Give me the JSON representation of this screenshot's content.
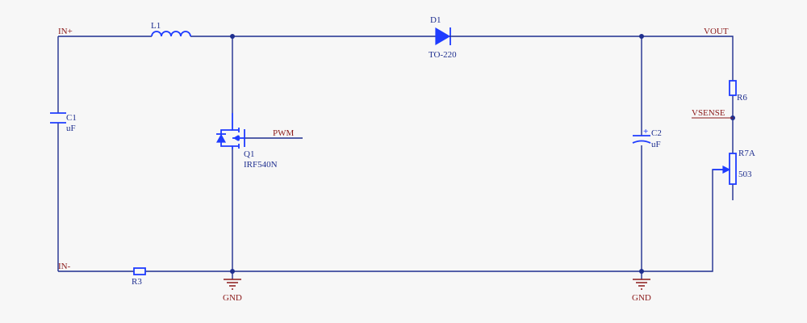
{
  "nets": {
    "in_plus": "IN+",
    "in_minus": "IN-",
    "vout": "VOUT",
    "vsense": "VSENSE",
    "pwm": "PWM",
    "gnd_left": "GND",
    "gnd_right": "GND"
  },
  "components": {
    "L1": {
      "ref": "L1"
    },
    "D1": {
      "ref": "D1",
      "value": "TO-220"
    },
    "C1": {
      "ref": "C1",
      "value": "uF"
    },
    "C2": {
      "ref": "C2",
      "value": "uF",
      "polarity": "+"
    },
    "Q1": {
      "ref": "Q1",
      "value": "IRF540N"
    },
    "R3": {
      "ref": "R3"
    },
    "R6": {
      "ref": "R6"
    },
    "R7A": {
      "ref": "R7A",
      "value": "503"
    }
  },
  "colors": {
    "wire": "#1f2f8f",
    "component_highlight": "#1f3cff",
    "net_label": "#8b1a1a",
    "background": "#f7f7f7"
  }
}
